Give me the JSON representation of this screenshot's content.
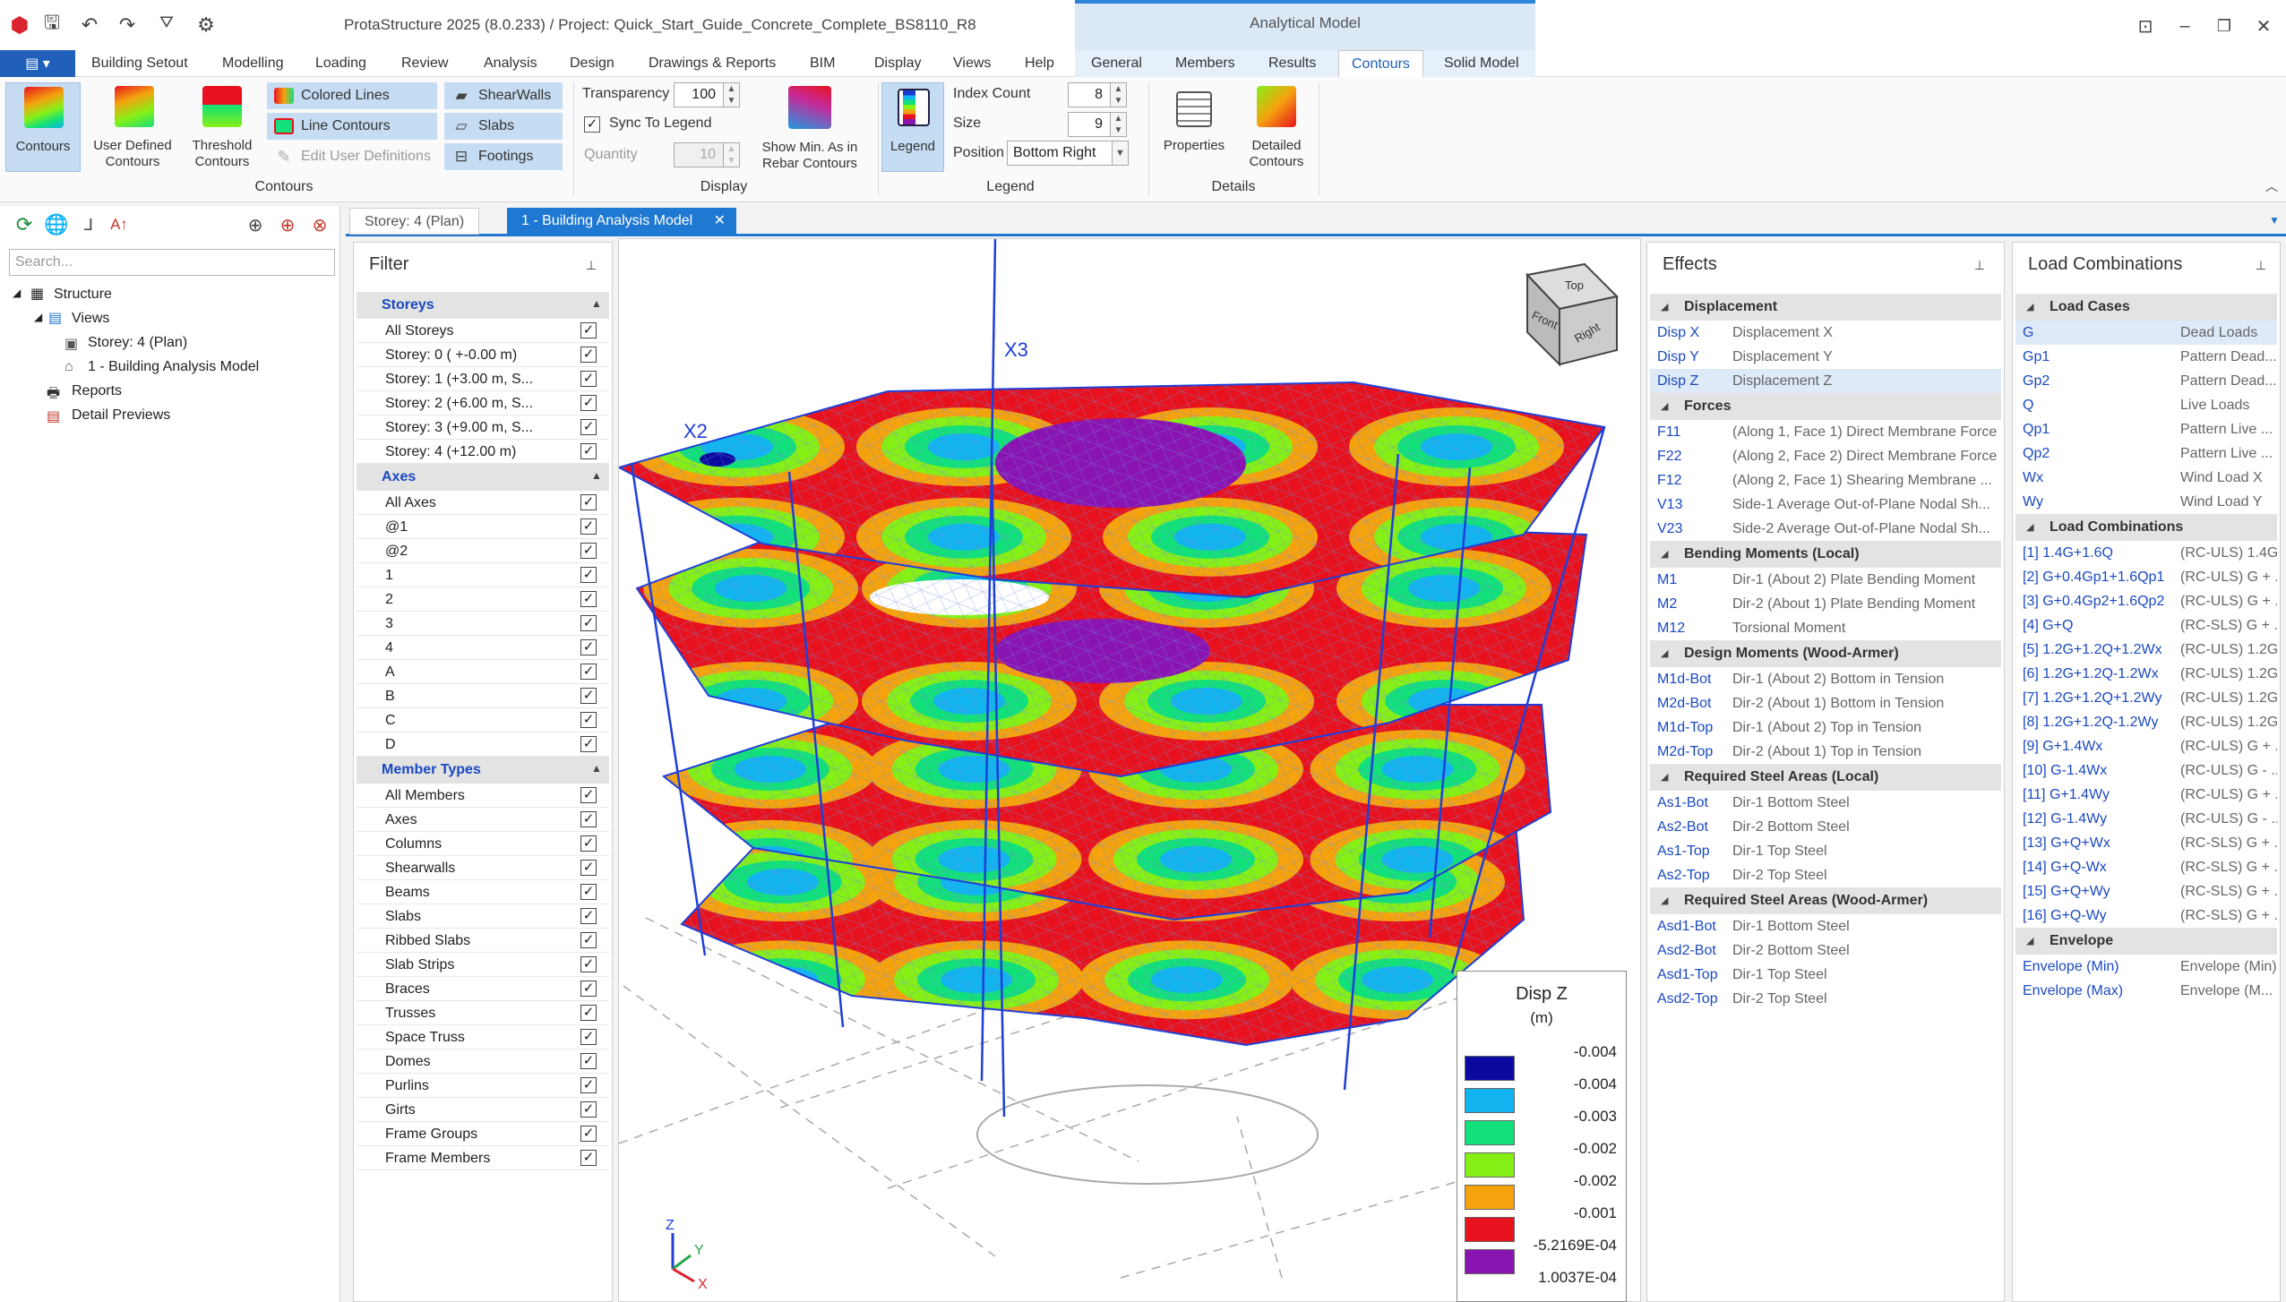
{
  "app": {
    "title": "ProtaStructure 2025 (8.0.233) / Project: Quick_Start_Guide_Concrete_Complete_BS8110_R8",
    "context_group": "Analytical Model"
  },
  "ribbon_tabs": [
    "Building Setout",
    "Modelling",
    "Loading",
    "Review",
    "Analysis",
    "Design",
    "Drawings & Reports",
    "BIM",
    "Display",
    "Views",
    "Help",
    "General",
    "Members",
    "Results",
    "Contours",
    "Solid Model"
  ],
  "active_tab": "Contours",
  "ribbon": {
    "contours_btn": "Contours",
    "user_defined_1": "User Defined",
    "user_defined_2": "Contours",
    "threshold_1": "Threshold",
    "threshold_2": "Contours",
    "colored_lines": "Colored Lines",
    "line_contours": "Line Contours",
    "edit_user_defs": "Edit User Definitions",
    "shearwalls": "ShearWalls",
    "slabs": "Slabs",
    "footings": "Footings",
    "group_contours": "Contours",
    "transparency_label": "Transparency",
    "transparency_value": "100",
    "sync_legend": "Sync To Legend",
    "quantity_label": "Quantity",
    "quantity_value": "10",
    "show_min_1": "Show Min. As in",
    "show_min_2": "Rebar Contours",
    "group_display": "Display",
    "legend_btn": "Legend",
    "index_count_label": "Index Count",
    "index_count_value": "8",
    "size_label": "Size",
    "size_value": "9",
    "position_label": "Position",
    "position_value": "Bottom Right",
    "group_legend": "Legend",
    "properties": "Properties",
    "detailed_1": "Detailed",
    "detailed_2": "Contours",
    "group_details": "Details"
  },
  "tree": {
    "search_placeholder": "Search...",
    "items": [
      "Structure",
      "Views",
      "Storey: 4 (Plan)",
      "1 - Building Analysis Model",
      "Reports",
      "Detail Previews"
    ]
  },
  "doc_tabs": [
    "Storey: 4 (Plan)",
    "1 - Building Analysis Model"
  ],
  "filter": {
    "title": "Filter",
    "storeys_header": "Storeys",
    "storeys": [
      "All Storeys",
      "Storey: 0 ( +-0.00 m)",
      "Storey: 1 (+3.00 m, S...",
      "Storey: 2 (+6.00 m, S...",
      "Storey: 3 (+9.00 m, S...",
      "Storey: 4 (+12.00 m)"
    ],
    "axes_header": "Axes",
    "axes": [
      "All Axes",
      "@1",
      "@2",
      "1",
      "2",
      "3",
      "4",
      "A",
      "B",
      "C",
      "D"
    ],
    "member_types_header": "Member Types",
    "member_types": [
      "All Members",
      "Axes",
      "Columns",
      "Shearwalls",
      "Beams",
      "Slabs",
      "Ribbed Slabs",
      "Slab Strips",
      "Braces",
      "Trusses",
      "Space Truss",
      "Domes",
      "Purlins",
      "Girts",
      "Frame Groups",
      "Frame Members"
    ]
  },
  "effects": {
    "title": "Effects",
    "sections": [
      {
        "header": "Displacement",
        "rows": [
          [
            "Disp X",
            "Displacement X"
          ],
          [
            "Disp Y",
            "Displacement Y"
          ],
          [
            "Disp Z",
            "Displacement Z"
          ]
        ]
      },
      {
        "header": "Forces",
        "rows": [
          [
            "F11",
            "(Along 1, Face 1) Direct Membrane Force"
          ],
          [
            "F22",
            "(Along 2, Face 2) Direct Membrane Force"
          ],
          [
            "F12",
            "(Along 2, Face 1) Shearing Membrane ..."
          ],
          [
            "V13",
            "Side-1 Average Out-of-Plane Nodal Sh..."
          ],
          [
            "V23",
            "Side-2 Average Out-of-Plane Nodal Sh..."
          ]
        ]
      },
      {
        "header": "Bending Moments (Local)",
        "rows": [
          [
            "M1",
            "Dir-1 (About 2) Plate Bending Moment"
          ],
          [
            "M2",
            "Dir-2 (About 1) Plate Bending Moment"
          ],
          [
            "M12",
            "Torsional Moment"
          ]
        ]
      },
      {
        "header": "Design Moments (Wood-Armer)",
        "rows": [
          [
            "M1d-Bot",
            "Dir-1 (About 2) Bottom in Tension"
          ],
          [
            "M2d-Bot",
            "Dir-2 (About 1) Bottom in Tension"
          ],
          [
            "M1d-Top",
            "Dir-1 (About 2) Top in Tension"
          ],
          [
            "M2d-Top",
            "Dir-2 (About 1) Top in Tension"
          ]
        ]
      },
      {
        "header": "Required Steel Areas (Local)",
        "rows": [
          [
            "As1-Bot",
            "Dir-1 Bottom Steel"
          ],
          [
            "As2-Bot",
            "Dir-2 Bottom Steel"
          ],
          [
            "As1-Top",
            "Dir-1 Top Steel"
          ],
          [
            "As2-Top",
            "Dir-2 Top Steel"
          ]
        ]
      },
      {
        "header": "Required Steel Areas (Wood-Armer)",
        "rows": [
          [
            "Asd1-Bot",
            "Dir-1 Bottom Steel"
          ],
          [
            "Asd2-Bot",
            "Dir-2 Bottom Steel"
          ],
          [
            "Asd1-Top",
            "Dir-1 Top Steel"
          ],
          [
            "Asd2-Top",
            "Dir-2 Top Steel"
          ]
        ]
      }
    ]
  },
  "load_combinations": {
    "title": "Load Combinations",
    "cases_header": "Load Cases",
    "cases": [
      [
        "G",
        "Dead Loads"
      ],
      [
        "Gp1",
        "Pattern Dead..."
      ],
      [
        "Gp2",
        "Pattern Dead..."
      ],
      [
        "Q",
        "Live Loads"
      ],
      [
        "Qp1",
        "Pattern Live ..."
      ],
      [
        "Qp2",
        "Pattern Live ..."
      ],
      [
        "Wx",
        "Wind Load X"
      ],
      [
        "Wy",
        "Wind Load Y"
      ]
    ],
    "combos_header": "Load Combinations",
    "combos": [
      [
        "[1] 1.4G+1.6Q",
        "(RC-ULS) 1.4G..."
      ],
      [
        "[2] G+0.4Gp1+1.6Qp1",
        "(RC-ULS) G + ..."
      ],
      [
        "[3] G+0.4Gp2+1.6Qp2",
        "(RC-ULS) G + ..."
      ],
      [
        "[4] G+Q",
        "(RC-SLS) G + ..."
      ],
      [
        "[5] 1.2G+1.2Q+1.2Wx",
        "(RC-ULS) 1.2G..."
      ],
      [
        "[6] 1.2G+1.2Q-1.2Wx",
        "(RC-ULS) 1.2G..."
      ],
      [
        "[7] 1.2G+1.2Q+1.2Wy",
        "(RC-ULS) 1.2G..."
      ],
      [
        "[8] 1.2G+1.2Q-1.2Wy",
        "(RC-ULS) 1.2G..."
      ],
      [
        "[9] G+1.4Wx",
        "(RC-ULS) G + ..."
      ],
      [
        "[10] G-1.4Wx",
        "(RC-ULS) G - ..."
      ],
      [
        "[11] G+1.4Wy",
        "(RC-ULS) G + ..."
      ],
      [
        "[12] G-1.4Wy",
        "(RC-ULS) G - ..."
      ],
      [
        "[13] G+Q+Wx",
        "(RC-SLS) G + ..."
      ],
      [
        "[14] G+Q-Wx",
        "(RC-SLS) G + ..."
      ],
      [
        "[15] G+Q+Wy",
        "(RC-SLS) G + ..."
      ],
      [
        "[16] G+Q-Wy",
        "(RC-SLS) G + ..."
      ]
    ],
    "envelope_header": "Envelope",
    "envelopes": [
      [
        "Envelope (Min)",
        "Envelope (Min)"
      ],
      [
        "Envelope (Max)",
        "Envelope (M..."
      ]
    ]
  },
  "viewport": {
    "axis_labels": [
      "X3",
      "X2"
    ],
    "cube": [
      "Top",
      "Front",
      "Right"
    ],
    "triad": [
      "Z",
      "Y",
      "X"
    ],
    "legend": {
      "title": "Disp Z",
      "unit": "(m)",
      "colors": [
        "#0a0aa0",
        "#11b4ee",
        "#12e07a",
        "#86f016",
        "#f5a20f",
        "#e8121e",
        "#8a14b2"
      ],
      "values": [
        "-0.004",
        "-0.004",
        "-0.003",
        "-0.002",
        "-0.002",
        "-0.001",
        "-5.2169E-04",
        "1.0037E-04"
      ]
    }
  }
}
